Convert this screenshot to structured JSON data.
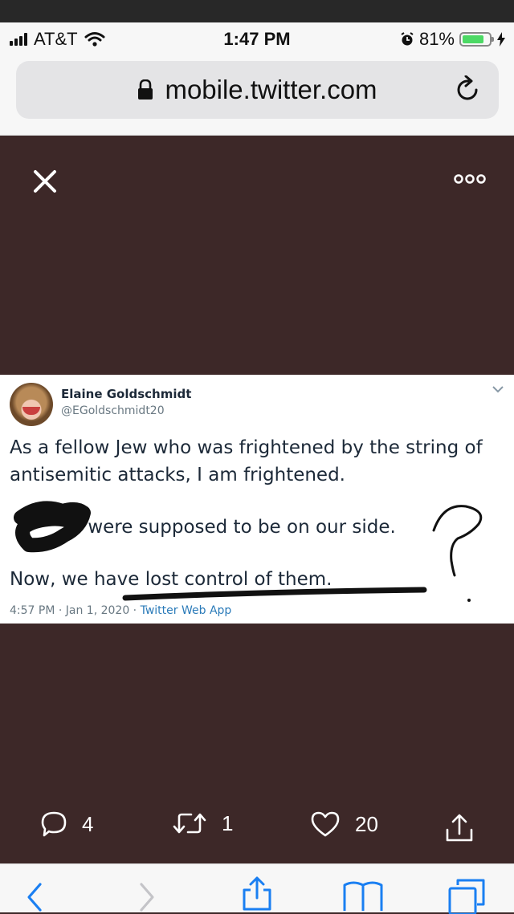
{
  "status_bar": {
    "carrier": "AT&T",
    "time": "1:47 PM",
    "battery_percent": "81%",
    "battery_level": 0.81
  },
  "browser": {
    "url": "mobile.twitter.com"
  },
  "tweet": {
    "author_name": "Elaine Goldschmidt",
    "author_handle": "@EGoldschmidt20",
    "paragraph_1": "As a fellow Jew who was frightened by the string of antisemitic attacks, I am frightened.",
    "paragraph_2_visible": "were supposed to be on our side.",
    "paragraph_3": "Now, we have lost control of them.",
    "timestamp": "4:57 PM · Jan 1, 2020 · ",
    "source": "Twitter Web App"
  },
  "actions": {
    "replies": "4",
    "retweets": "1",
    "likes": "20"
  },
  "icons": [
    "close-icon",
    "more-icon",
    "lock-icon",
    "reload-icon",
    "chevron-down-icon",
    "reply-icon",
    "retweet-icon",
    "like-icon",
    "share-icon",
    "back-icon",
    "forward-icon",
    "safari-share-icon",
    "bookmarks-icon",
    "tabs-icon"
  ],
  "colors": {
    "background": "#3d2828",
    "battery": "#4cd964",
    "link": "#2b7bb9",
    "safari_blue": "#1a7ff2"
  }
}
